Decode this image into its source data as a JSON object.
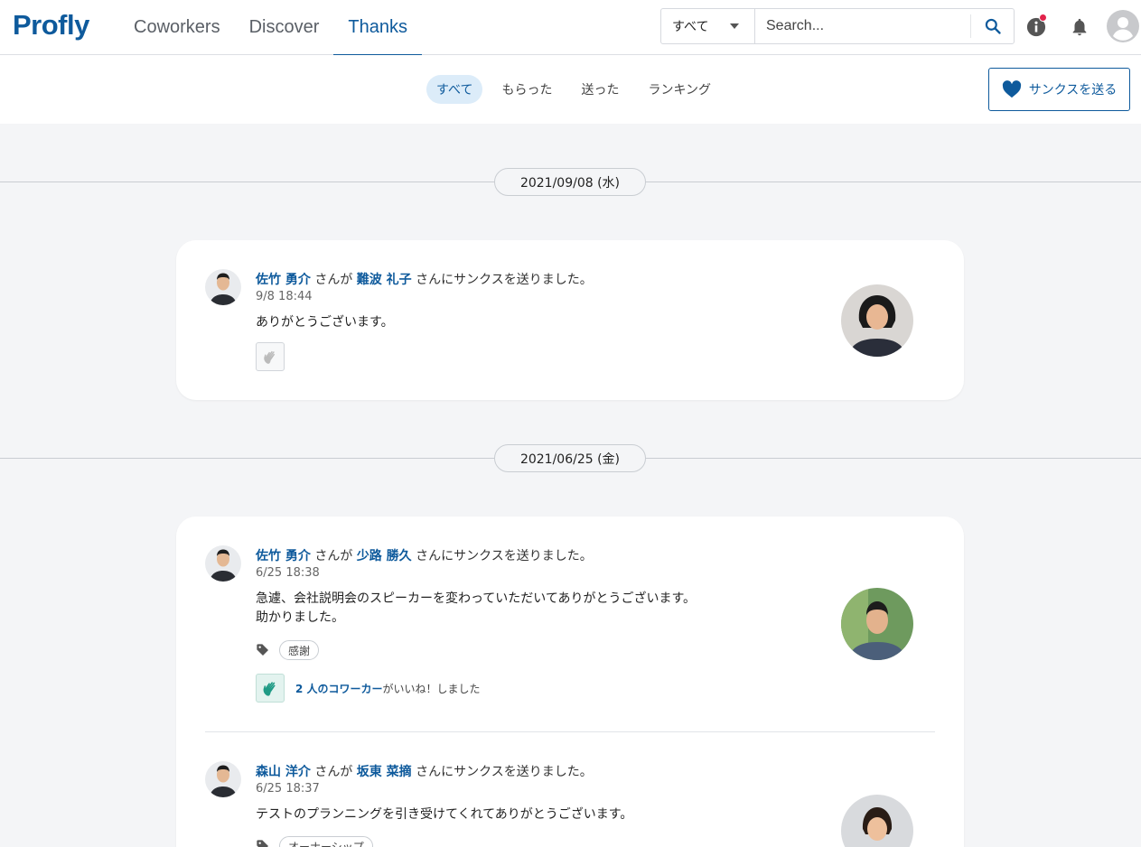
{
  "app": {
    "logo": "Profly"
  },
  "nav": {
    "items": [
      {
        "label": "Coworkers"
      },
      {
        "label": "Discover"
      },
      {
        "label": "Thanks"
      }
    ],
    "active": "Thanks"
  },
  "search": {
    "scope": "すべて",
    "placeholder": "Search..."
  },
  "subtabs": [
    {
      "label": "すべて"
    },
    {
      "label": "もらった"
    },
    {
      "label": "送った"
    },
    {
      "label": "ランキング"
    }
  ],
  "send_button": {
    "label": "サンクスを送る"
  },
  "groups": [
    {
      "date": "2021/09/08 (水)",
      "entries": [
        {
          "sender": "佐竹 勇介",
          "connector": "さんが",
          "receiver": "難波 礼子",
          "suffix": "さんにサンクスを送りました。",
          "time": "9/8 18:44",
          "message": [
            "ありがとうございます。"
          ]
        }
      ]
    },
    {
      "date": "2021/06/25 (金)",
      "entries": [
        {
          "sender": "佐竹 勇介",
          "connector": "さんが",
          "receiver": "少路 勝久",
          "suffix": "さんにサンクスを送りました。",
          "time": "6/25 18:38",
          "message": [
            "急遽、会社説明会のスピーカーを変わっていただいてありがとうございます。",
            "助かりました。"
          ],
          "tag": "感謝",
          "likes_count": "2 人のコワーカー",
          "likes_suffix": "がいいね！しました"
        },
        {
          "sender": "森山 洋介",
          "connector": "さんが",
          "receiver": "坂東 菜摘",
          "suffix": "さんにサンクスを送りました。",
          "time": "6/25 18:37",
          "message": [
            "テストのプランニングを引き受けてくれてありがとうございます。"
          ],
          "tag": "オーナーシップ"
        }
      ]
    }
  ],
  "colors": {
    "brand": "#0e5a9c",
    "accent": "#e2234b",
    "background": "#f4f5f7"
  }
}
